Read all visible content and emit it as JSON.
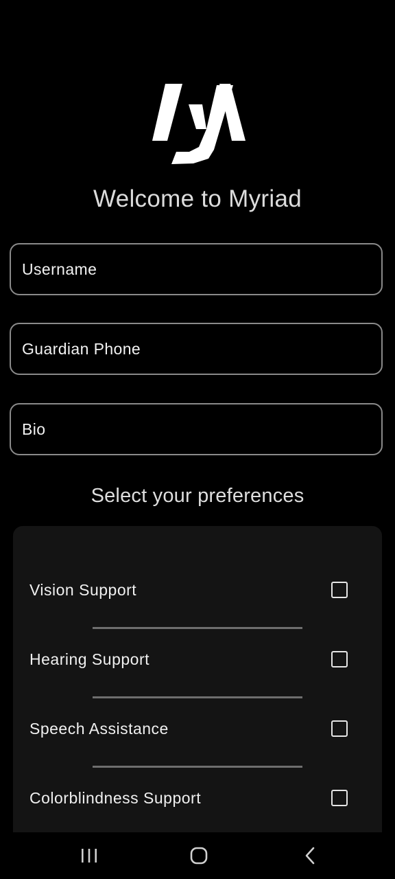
{
  "app": {
    "logo_icon": "myriad-logo",
    "title": "Welcome to Myriad"
  },
  "form": {
    "username": {
      "placeholder": "Username",
      "value": ""
    },
    "guardian_phone": {
      "placeholder": "Guardian Phone",
      "value": ""
    },
    "bio": {
      "placeholder": "Bio",
      "value": ""
    }
  },
  "preferences": {
    "title": "Select your preferences",
    "items": [
      {
        "label": "Vision Support",
        "checked": false
      },
      {
        "label": "Hearing Support",
        "checked": false
      },
      {
        "label": "Speech Assistance",
        "checked": false
      },
      {
        "label": "Colorblindness Support",
        "checked": false
      }
    ]
  },
  "navbar": {
    "recents_icon": "recents-icon",
    "home_icon": "home-icon",
    "back_icon": "back-icon"
  },
  "colors": {
    "background": "#000000",
    "card": "#141414",
    "border": "#8a8a8a",
    "text": "#e6e6e6"
  }
}
